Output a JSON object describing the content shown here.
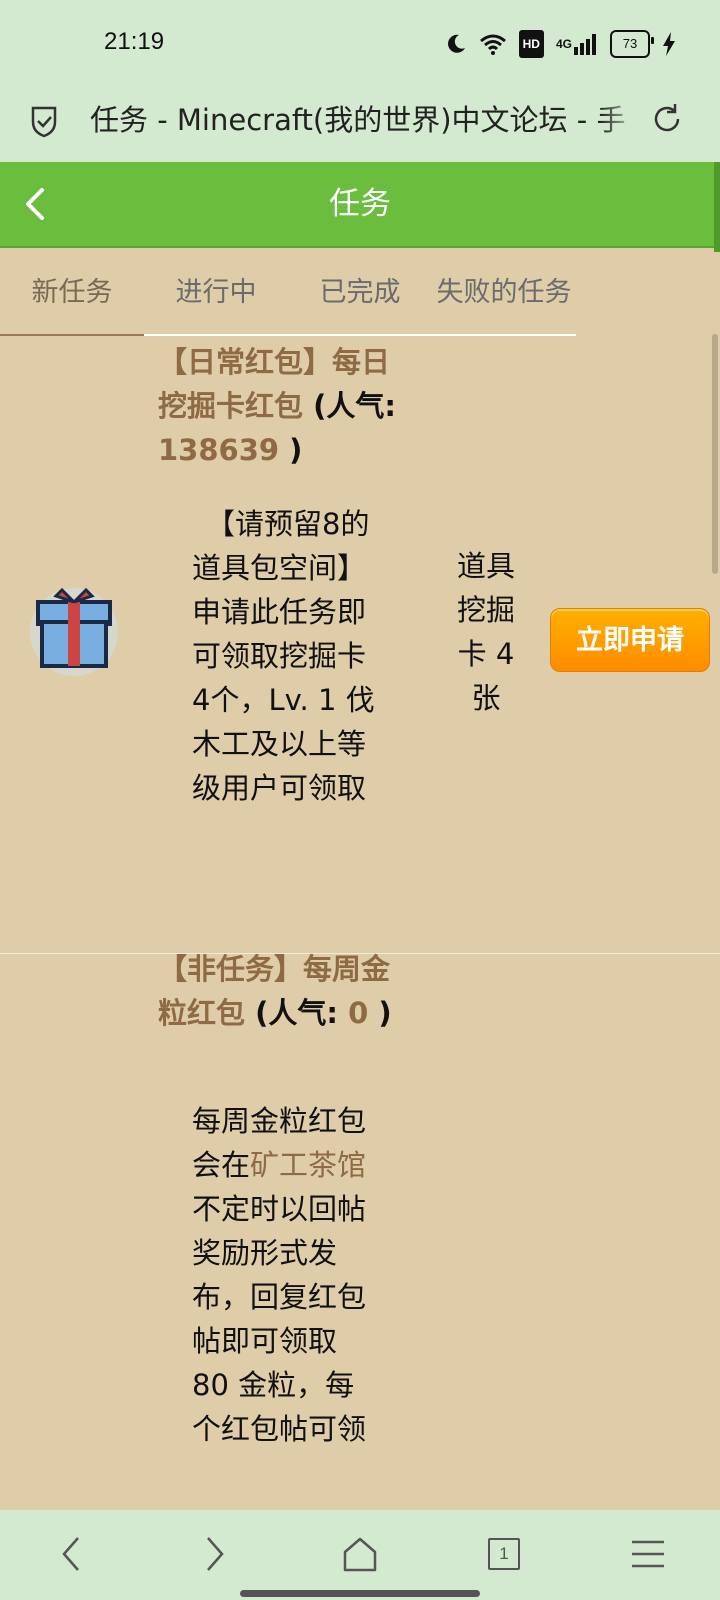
{
  "status_bar": {
    "time": "21:19",
    "hd_label": "HD",
    "network_label": "4G",
    "battery_level": "73"
  },
  "browser": {
    "page_title": "任务 - Minecraft(我的世界)中文论坛 - 手"
  },
  "header": {
    "title": "任务",
    "accent_color": "#6bbd3e"
  },
  "tabs": [
    {
      "label": "新任务",
      "active": true
    },
    {
      "label": "进行中",
      "active": false
    },
    {
      "label": "已完成",
      "active": false
    },
    {
      "label": "失败的任务",
      "active": false
    }
  ],
  "tasks": [
    {
      "title_link": "【日常红包】每日挖掘卡红包",
      "popularity_prefix": " (人气: ",
      "popularity_value": "138639",
      "popularity_suffix": " )",
      "description": "【请预留8的道具包空间】申请此任务即可领取挖掘卡4个，Lv. 1 伐木工及以上等级用户可领取",
      "reward": "道具挖掘卡 4 张",
      "apply_label": "立即申请",
      "icon": "gift-icon"
    },
    {
      "title_link": "【非任务】每周金粒红包",
      "popularity_prefix": " (人气: ",
      "popularity_value": "0",
      "popularity_suffix": " )",
      "description_before": "每周金粒红包会在",
      "description_link": "矿工茶馆",
      "description_after": "不定时以回帖奖励形式发布，回复红包帖即可领取 80 金粒，每个红包帖可领"
    }
  ],
  "bottom_nav": {
    "tab_count": "1",
    "icons": [
      "back-arrow-icon",
      "forward-arrow-icon",
      "home-icon",
      "tabs-icon",
      "menu-icon"
    ]
  }
}
